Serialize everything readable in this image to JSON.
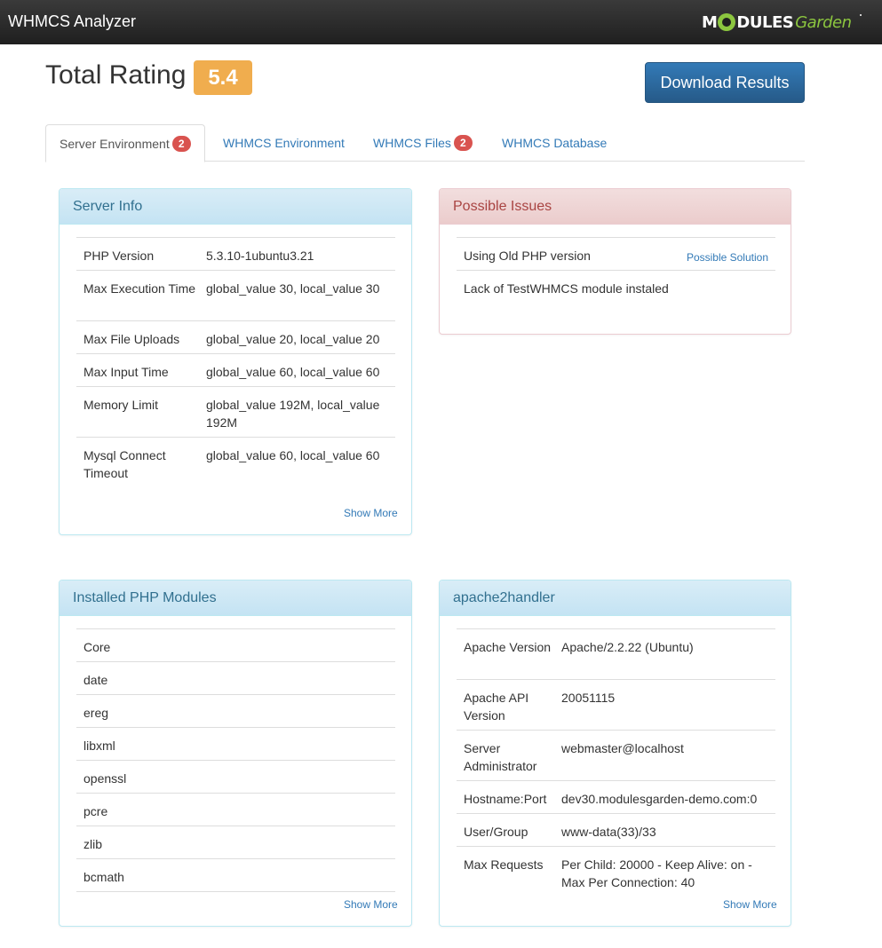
{
  "header": {
    "app_title": "WHMCS Analyzer",
    "logo": {
      "m": "M",
      "rest": "DULES",
      "garden": "Garden"
    }
  },
  "rating": {
    "title": "Total Rating",
    "value": "5.4"
  },
  "download_label": "Download Results",
  "tabs": [
    {
      "label": "Server Environment",
      "badge": "2",
      "active": true
    },
    {
      "label": "WHMCS Environment"
    },
    {
      "label": "WHMCS Files",
      "badge": "2"
    },
    {
      "label": "WHMCS Database"
    }
  ],
  "server_info": {
    "title": "Server Info",
    "rows": [
      {
        "key": "PHP Version",
        "value": "5.3.10-1ubuntu3.21"
      },
      {
        "key": "Max Execution Time",
        "value": "global_value 30, local_value 30"
      },
      {
        "key": "Max File Uploads",
        "value": "global_value 20, local_value 20"
      },
      {
        "key": "Max Input Time",
        "value": "global_value 60, local_value 60"
      },
      {
        "key": "Memory Limit",
        "value": "global_value 192M, local_value 192M"
      },
      {
        "key": "Mysql Connect Timeout",
        "value": "global_value 60, local_value 60"
      }
    ],
    "show_more": "Show More"
  },
  "possible_issues": {
    "title": "Possible Issues",
    "items": [
      {
        "text": "Using Old PHP version",
        "link": "Possible Solution"
      },
      {
        "text": "Lack of TestWHMCS module instaled"
      }
    ]
  },
  "php_modules": {
    "title": "Installed PHP Modules",
    "items": [
      "Core",
      "date",
      "ereg",
      "libxml",
      "openssl",
      "pcre",
      "zlib",
      "bcmath"
    ],
    "show_more": "Show More"
  },
  "apache": {
    "title": "apache2handler",
    "rows": [
      {
        "key": "Apache Version",
        "value": "Apache/2.2.22 (Ubuntu)"
      },
      {
        "key": "Apache API Version",
        "value": "20051115"
      },
      {
        "key": "Server Administrator",
        "value": "webmaster@localhost"
      },
      {
        "key": "Hostname:Port",
        "value": "dev30.modulesgarden-demo.com:0"
      },
      {
        "key": "User/Group",
        "value": "www-data(33)/33"
      },
      {
        "key": "Max Requests",
        "value": "Per Child: 20000 - Keep Alive: on - Max Per Connection: 40"
      }
    ],
    "show_more": "Show More"
  },
  "colors": {
    "accent": "#337ab7",
    "rating_badge": "#f0ad4e",
    "tab_badge": "#d9534f",
    "logo_green": "#8cc63f"
  }
}
